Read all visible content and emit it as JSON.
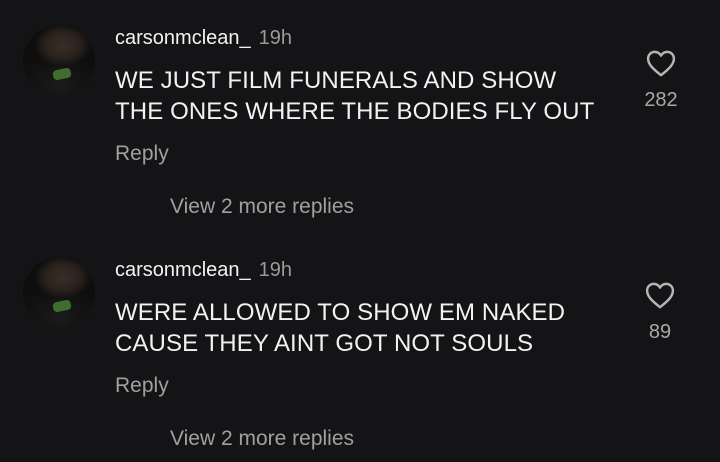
{
  "comments": [
    {
      "username": "carsonmclean_",
      "time": "19h",
      "lines": [
        "WE JUST FILM FUNERALS AND SHOW",
        "THE ONES WHERE THE BODIES FLY OUT"
      ],
      "reply_label": "Reply",
      "view_more": "View 2 more replies",
      "likes": "282",
      "like_icon": "heart-outline-icon"
    },
    {
      "username": "carsonmclean_",
      "time": "19h",
      "lines": [
        "WERE ALLOWED TO SHOW EM NAKED",
        "CAUSE THEY AINT GOT NOT SOULS"
      ],
      "reply_label": "Reply",
      "view_more": "View 2 more replies",
      "likes": "89",
      "like_icon": "heart-outline-icon"
    }
  ],
  "colors": {
    "background": "#141416",
    "primary_text": "#f2f2f2",
    "secondary_text": "#a0a0a0"
  }
}
